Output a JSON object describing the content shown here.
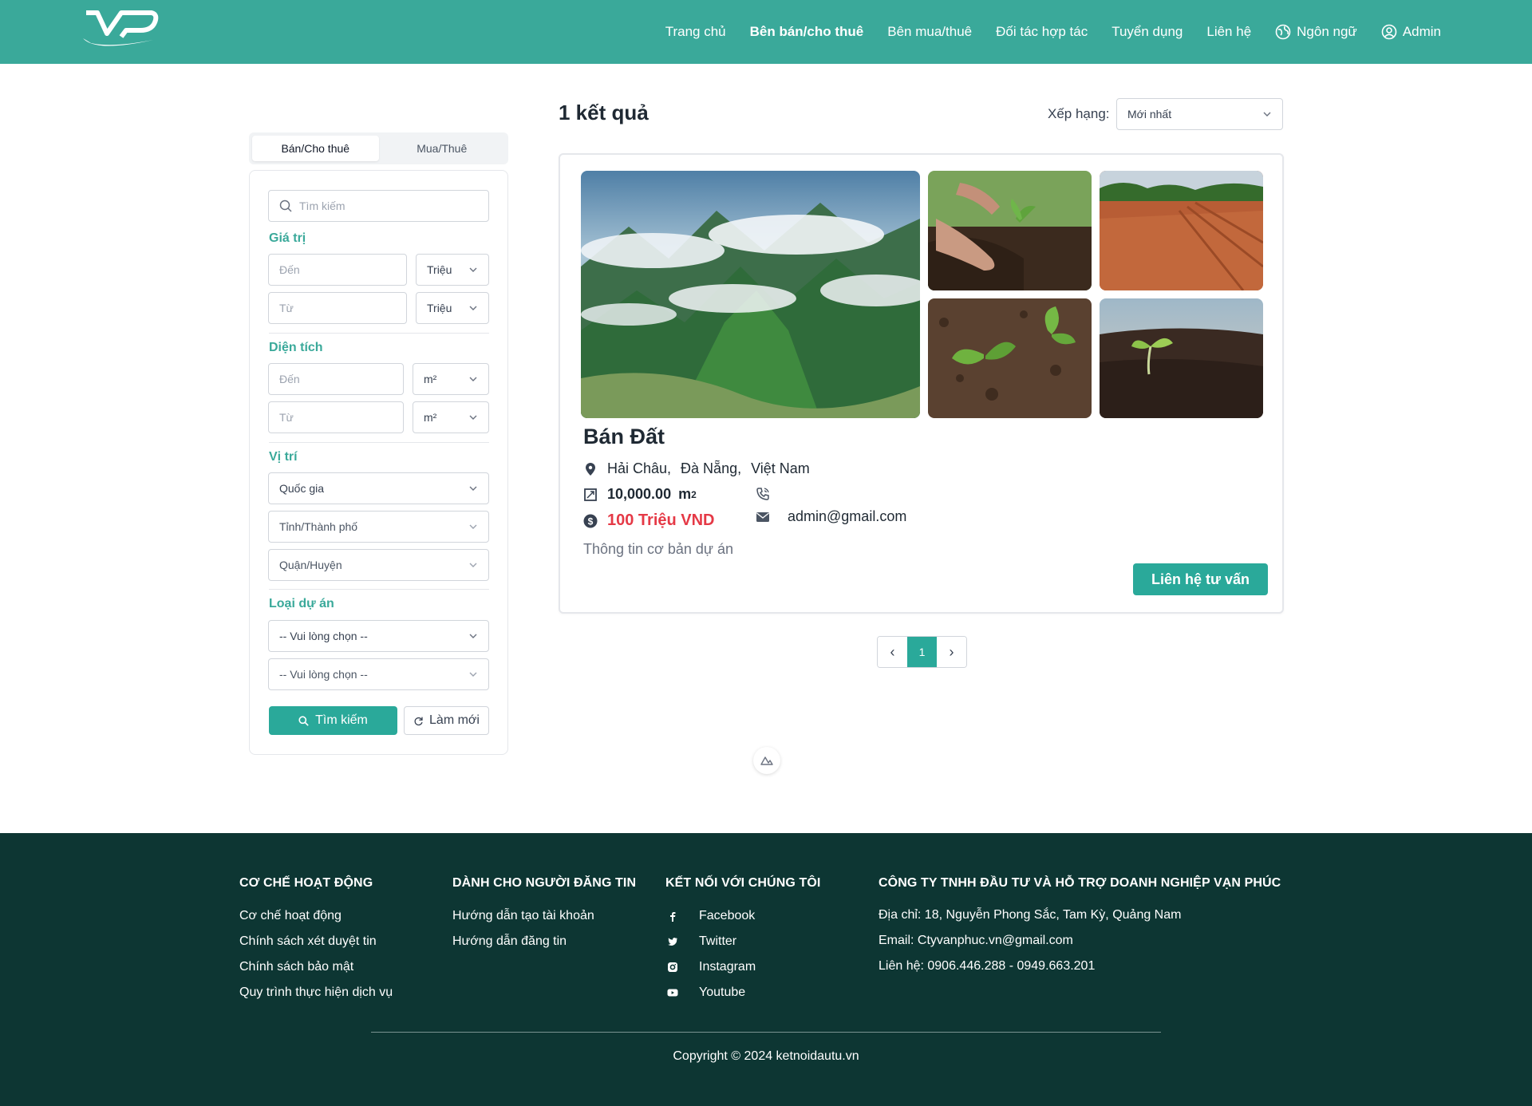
{
  "colors": {
    "primary": "#3aa99a",
    "button": "#2aa99a",
    "price": "#e53946",
    "footer_bg": "#0d3633"
  },
  "header": {
    "logo_icon": "vp-logo-icon",
    "nav": [
      {
        "label": "Trang chủ",
        "active": false
      },
      {
        "label": "Bên bán/cho thuê",
        "active": true
      },
      {
        "label": "Bên mua/thuê",
        "active": false
      },
      {
        "label": "Đối tác hợp tác",
        "active": false
      },
      {
        "label": "Tuyển dụng",
        "active": false
      },
      {
        "label": "Liên hệ",
        "active": false
      }
    ],
    "language_label": "Ngôn ngữ",
    "language_icon": "globe-icon",
    "user_label": "Admin",
    "user_icon": "user-circle-icon"
  },
  "sidebar": {
    "tabs": [
      "Bán/Cho thuê",
      "Mua/Thuê"
    ],
    "active_tab": 0,
    "search_placeholder": "Tìm kiếm",
    "price": {
      "label": "Giá trị",
      "to_placeholder": "Đến",
      "from_placeholder": "Từ",
      "unit": "Triệu"
    },
    "area": {
      "label": "Diện tích",
      "to_placeholder": "Đến",
      "from_placeholder": "Từ",
      "unit": "m²"
    },
    "location": {
      "label": "Vị trí",
      "country": "Quốc gia",
      "province": "Tỉnh/Thành phố",
      "district": "Quận/Huyện"
    },
    "project_type": {
      "label": "Loại dự án",
      "select1": "-- Vui lòng chọn --",
      "select2": "-- Vui lòng chọn --"
    },
    "search_button": "Tìm kiếm",
    "reset_button": "Làm mới"
  },
  "results": {
    "count_label": "1 kết quả",
    "sort_label": "Xếp hạng:",
    "sort_value": "Mới nhất"
  },
  "listing": {
    "title": "Bán Đất",
    "location": {
      "ward": "Hải Châu,",
      "city": "Đà Nẵng,",
      "country": "Việt Nam"
    },
    "area_value": "10,000.00",
    "area_unit": "m",
    "area_sup": "2",
    "price": "100 Triệu VND",
    "phone": "",
    "email": "admin@gmail.com",
    "description": "Thông tin cơ bản dự án",
    "contact_button": "Liên hệ tư vấn"
  },
  "pagination": {
    "prev": "‹",
    "current": "1",
    "next": "›"
  },
  "footer": {
    "col1": {
      "title": "Cơ chế hoạt động",
      "links": [
        "Cơ chế hoạt động",
        "Chính sách xét duyệt tin",
        "Chính sách bảo mật",
        "Quy trình thực hiện dịch vụ"
      ]
    },
    "col2": {
      "title": "Dành cho người đăng tin",
      "links": [
        "Hướng dẫn tạo tài khoản",
        "Hướng dẫn đăng tin"
      ]
    },
    "col3": {
      "title": "Kết nối với chúng tôi",
      "links": [
        "Facebook",
        "Twitter",
        "Instagram",
        "Youtube"
      ]
    },
    "col4": {
      "title": "Công ty TNHH đầu tư và hỗ trợ doanh nghiệp Vạn Phúc",
      "lines": [
        "Địa chỉ: 18, Nguyễn Phong Sắc, Tam Kỳ, Quảng Nam",
        "Email: Ctyvanphuc.vn@gmail.com",
        "Liên hệ: 0906.446.288 - 0949.663.201"
      ]
    },
    "copyright": "Copyright © 2024 ketnoidautu.vn"
  }
}
